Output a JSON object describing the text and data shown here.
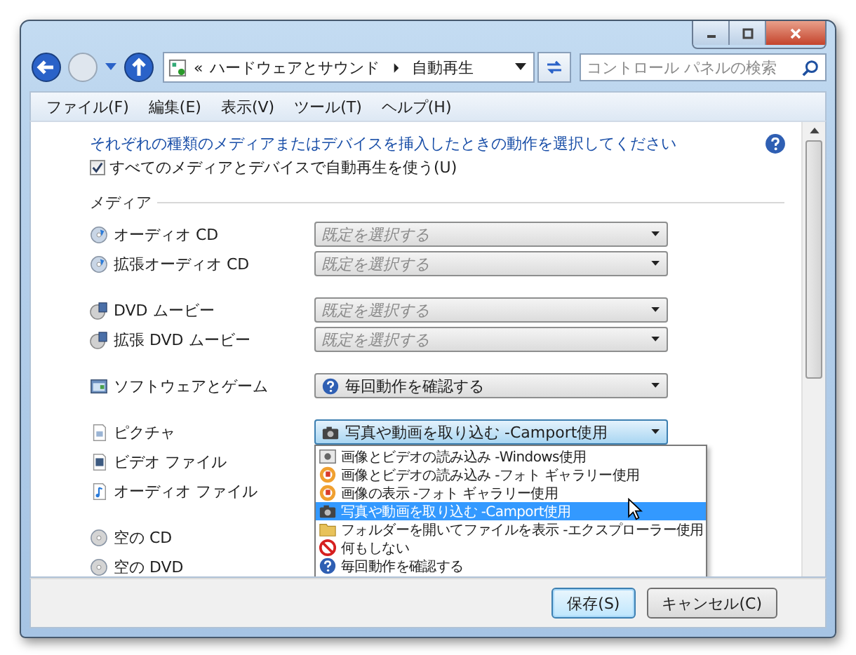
{
  "address_bar": {
    "overflow": "«",
    "crumbs": [
      "ハードウェアとサウンド",
      "自動再生"
    ]
  },
  "search": {
    "placeholder": "コントロール パネルの検索"
  },
  "menu": [
    "ファイル(F)",
    "編集(E)",
    "表示(V)",
    "ツール(T)",
    "ヘルプ(H)"
  ],
  "instruction": "それぞれの種類のメディアまたはデバイスを挿入したときの動作を選択してください",
  "autoplay_checkbox": {
    "label": "すべてのメディアとデバイスで自動再生を使う(U)",
    "checked": true
  },
  "section": "メディア",
  "media_groups": [
    [
      {
        "label": "オーディオ CD",
        "kind": "cd",
        "select": {
          "text": "既定を選択する",
          "kind": "default",
          "open": false
        }
      },
      {
        "label": "拡張オーディオ CD",
        "kind": "cd",
        "select": {
          "text": "既定を選択する",
          "kind": "default",
          "open": false
        }
      }
    ],
    [
      {
        "label": "DVD ムービー",
        "kind": "dvd",
        "select": {
          "text": "既定を選択する",
          "kind": "default",
          "open": false
        }
      },
      {
        "label": "拡張 DVD ムービー",
        "kind": "dvd",
        "select": {
          "text": "既定を選択する",
          "kind": "default",
          "open": false
        }
      }
    ],
    [
      {
        "label": "ソフトウェアとゲーム",
        "kind": "software",
        "select": {
          "text": "毎回動作を確認する",
          "kind": "ask",
          "open": false
        }
      }
    ],
    [
      {
        "label": "ピクチャ",
        "kind": "picture",
        "select": {
          "text": "写真や動画を取り込む -Camport使用",
          "kind": "camera",
          "open": true
        }
      },
      {
        "label": "ビデオ ファイル",
        "kind": "video"
      },
      {
        "label": "オーディオ ファイル",
        "kind": "audio"
      }
    ],
    [
      {
        "label": "空の CD",
        "kind": "blank"
      },
      {
        "label": "空の DVD",
        "kind": "blank"
      }
    ]
  ],
  "dropdown_options": [
    {
      "text": "画像とビデオの読み込み -Windows使用",
      "kind": "import",
      "selected": false
    },
    {
      "text": "画像とビデオの読み込み -フォト ギャラリー使用",
      "kind": "gallery",
      "selected": false
    },
    {
      "text": "画像の表示 -フォト ギャラリー使用",
      "kind": "gallery",
      "selected": false
    },
    {
      "text": "写真や動画を取り込む -Camport使用",
      "kind": "camera",
      "selected": true
    },
    {
      "text": "フォルダーを開いてファイルを表示 -エクスプローラー使用",
      "kind": "folder",
      "selected": false
    },
    {
      "text": "何もしない",
      "kind": "none",
      "selected": false
    },
    {
      "text": "毎回動作を確認する",
      "kind": "ask",
      "selected": false
    }
  ],
  "buttons": [
    {
      "label": "保存(S)",
      "default": true
    },
    {
      "label": "キャンセル(C)",
      "default": false
    }
  ]
}
